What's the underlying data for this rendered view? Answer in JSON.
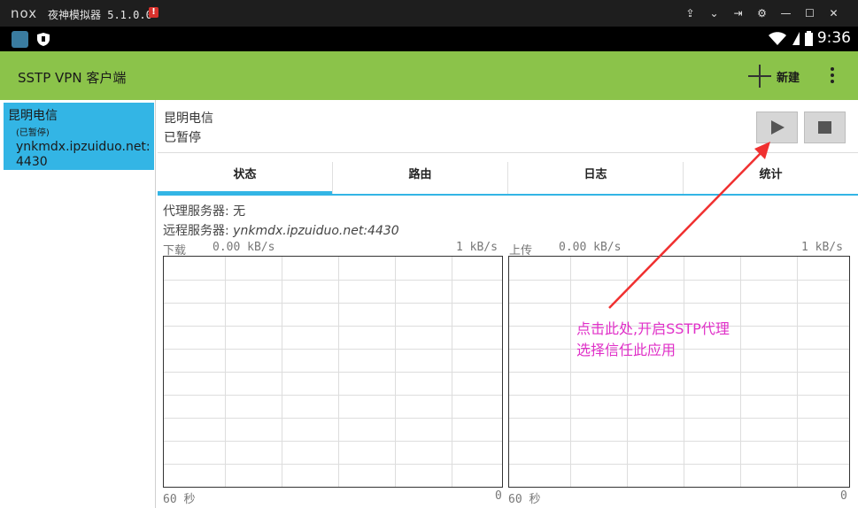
{
  "window": {
    "logo_text": "nox",
    "app_name": "夜神模拟器 5.1.0.0",
    "alert_badge": "!",
    "controls": [
      "pin-icon",
      "chevron-down-icon",
      "dock-icon",
      "gear-icon",
      "minimize-icon",
      "maximize-icon",
      "close-icon"
    ]
  },
  "statusbar": {
    "time": "9:36"
  },
  "appbar": {
    "title": "SSTP VPN 客户端",
    "add_label": "新建"
  },
  "profile": {
    "name": "昆明电信",
    "status": "(已暂停)",
    "host": "ynkmdx.ipzuiduo.net:4430"
  },
  "detail": {
    "name": "昆明电信",
    "state": "已暂停",
    "tabs": [
      "状态",
      "路由",
      "日志",
      "统计"
    ],
    "proxy_label": "代理服务器: ",
    "proxy_value": "无",
    "remote_label": "远程服务器: ",
    "remote_value": "ynkmdx.ipzuiduo.net:4430"
  },
  "graphs": {
    "download_label": "下载",
    "download_rate": "0.00 kB/s",
    "download_scale": "1 kB/s",
    "upload_label": "上传",
    "upload_rate": "0.00 kB/s",
    "upload_scale": "1 kB/s",
    "left_foot": "60 秒",
    "right_foot": "0"
  },
  "annotation": {
    "line1": "点击此处,开启SSTP代理",
    "line2": "选择信任此应用",
    "color": "#e030c8",
    "arrow_color": "#f03030"
  },
  "colors": {
    "appbar": "#8bc34a",
    "accent": "#33b5e5"
  }
}
